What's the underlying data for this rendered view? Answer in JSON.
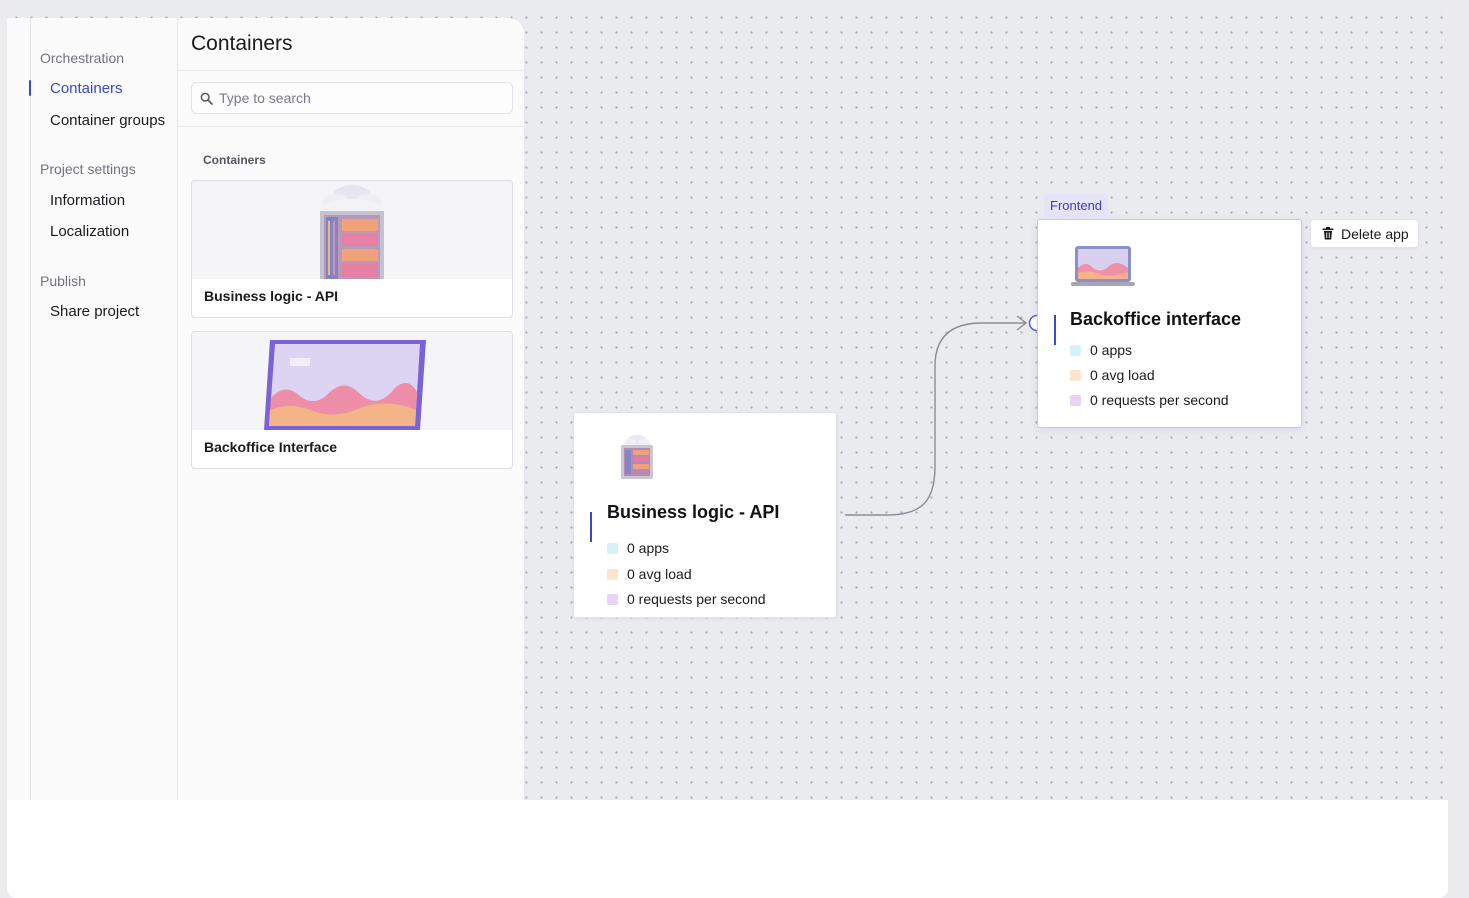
{
  "sidebar": {
    "sections": [
      {
        "title": "Orchestration",
        "items": [
          {
            "label": "Containers",
            "active": true
          },
          {
            "label": "Container groups",
            "active": false
          }
        ]
      },
      {
        "title": "Project settings",
        "items": [
          {
            "label": "Information",
            "active": false
          },
          {
            "label": "Localization",
            "active": false
          }
        ]
      },
      {
        "title": "Publish",
        "items": [
          {
            "label": "Share project",
            "active": false
          }
        ]
      }
    ]
  },
  "panel": {
    "title": "Containers",
    "search_placeholder": "Type to search",
    "section_label": "Containers",
    "cards": [
      {
        "label": "Business logic - API",
        "image": "server-rack-with-clouds-icon"
      },
      {
        "label": "Backoffice Interface",
        "image": "laptop-dashboard-icon"
      }
    ]
  },
  "canvas": {
    "nodes": [
      {
        "title": "Business logic - API",
        "icon": "server-rack-icon",
        "stats": [
          {
            "label": "0 apps",
            "color": "#d8f1f7"
          },
          {
            "label": "0 avg load",
            "color": "#fde5cd"
          },
          {
            "label": "0 requests per second",
            "color": "#e7d3f6"
          }
        ]
      },
      {
        "title": "Backoffice interface",
        "icon": "laptop-icon",
        "tag": "Frontend",
        "selected": true,
        "stats": [
          {
            "label": "0 apps",
            "color": "#d8f1f7"
          },
          {
            "label": "0 avg load",
            "color": "#fde5cd"
          },
          {
            "label": "0 requests per second",
            "color": "#e7d3f6"
          }
        ]
      }
    ],
    "delete_button_label": "Delete app"
  },
  "colors": {
    "accent": "#3a46d8",
    "tag_bg": "#e6e4fb",
    "canvas_bg": "#eaebee"
  }
}
